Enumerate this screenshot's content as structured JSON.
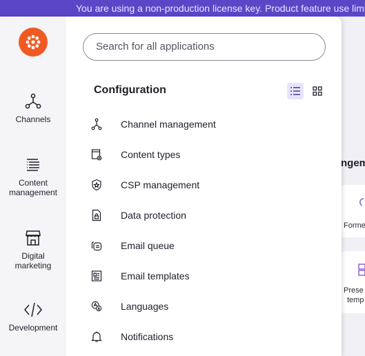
{
  "banner": {
    "text": "You are using a non-production license key. Product feature use limited"
  },
  "background_app": {
    "heading": "ngem",
    "tiles": [
      {
        "label": "Forme"
      },
      {
        "label_line1": "Prese",
        "label_line2": "temp"
      }
    ]
  },
  "rail": {
    "items": [
      {
        "label": "Channels",
        "icon": "channels-icon"
      },
      {
        "label_line1": "Content",
        "label_line2": "management",
        "icon": "content-management-icon"
      },
      {
        "label_line1": "Digital",
        "label_line2": "marketing",
        "icon": "storefront-icon"
      },
      {
        "label": "Development",
        "icon": "code-icon"
      }
    ]
  },
  "search": {
    "placeholder": "Search for all applications"
  },
  "section": {
    "title": "Configuration"
  },
  "menu": [
    {
      "label": "Channel management",
      "icon": "channels-icon"
    },
    {
      "label": "Content types",
      "icon": "content-type-icon"
    },
    {
      "label": "CSP management",
      "icon": "shield-star-icon"
    },
    {
      "label": "Data protection",
      "icon": "document-lock-icon"
    },
    {
      "label": "Email queue",
      "icon": "email-queue-icon"
    },
    {
      "label": "Email templates",
      "icon": "email-template-icon"
    },
    {
      "label": "Languages",
      "icon": "translate-icon"
    },
    {
      "label": "Notifications",
      "icon": "bell-icon"
    }
  ],
  "colors": {
    "accent": "#5b46c8",
    "brand_orange": "#f05a22",
    "toggle_active_bg": "#e8e3fb",
    "text": "#1f1f2b"
  }
}
